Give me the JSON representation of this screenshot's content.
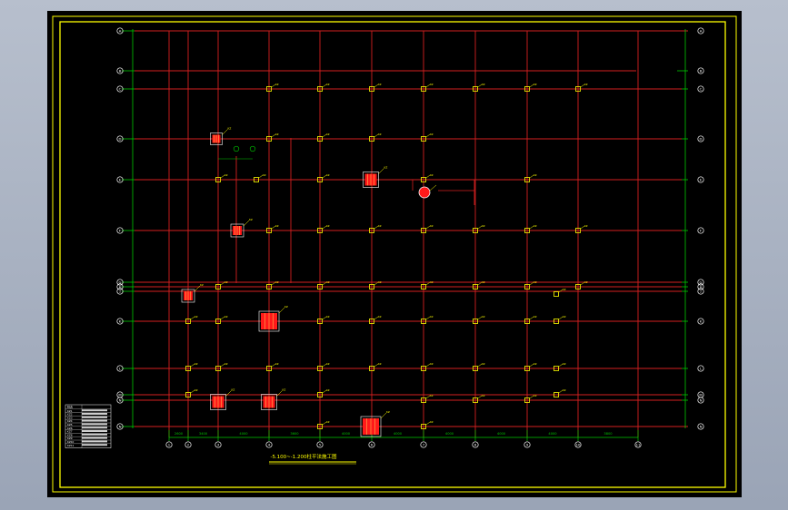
{
  "colors": {
    "background": "#000000",
    "frame": "#ffff00",
    "axis_line": "#d42020",
    "axis_extension": "#00c800",
    "column": "#ff1a1a",
    "annotation": "#ffff00",
    "bubble": "#ffffff",
    "viewport": "#a6afc0"
  },
  "drawing": {
    "title": "-5.100~-1.200柱平法施工图",
    "axes_horizontal": [
      "A",
      "B",
      "C",
      "D",
      "E",
      "F",
      "G",
      "H",
      "J",
      "K",
      "L",
      "M",
      "N"
    ],
    "axes_vertical": [
      "1",
      "2",
      "3",
      "4",
      "5",
      "6",
      "7",
      "8",
      "9",
      "10",
      "11",
      "12",
      "13",
      "14"
    ],
    "dimensions_bottom": [
      "2600",
      "3400",
      "4000",
      "3600",
      "4000",
      "4000",
      "4000",
      "4000",
      "4000",
      "3800",
      "7200"
    ],
    "column_tag": "KZ",
    "schedule": {
      "title": "柱表",
      "rows": [
        "KZ1",
        "KZ2",
        "KZ3",
        "KZ4",
        "KZ5",
        "KZ6",
        "KZ7",
        "KZ8",
        "KZ9",
        "KZ10",
        "KZ11"
      ]
    }
  }
}
